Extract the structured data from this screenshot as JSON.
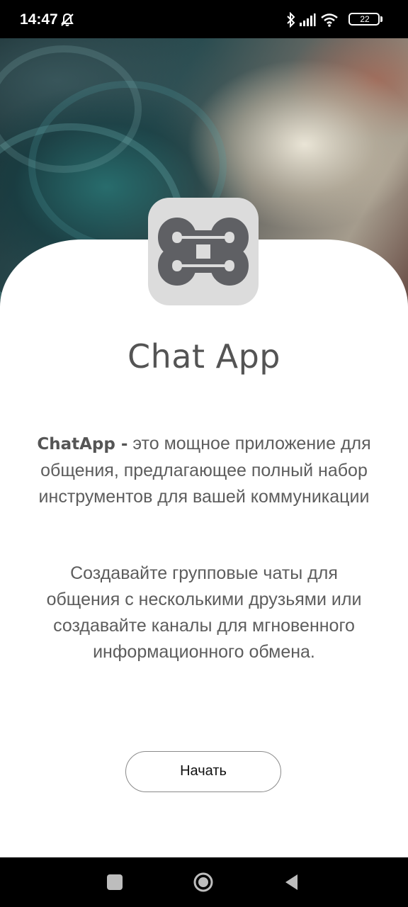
{
  "status_bar": {
    "time": "14:47",
    "battery_level": "22",
    "icons": [
      "mute-icon",
      "bluetooth-icon",
      "signal-icon",
      "wifi-icon",
      "battery-icon"
    ]
  },
  "app": {
    "title": "Chat App",
    "brand_name": "ChatApp -",
    "description_1": " это мощное приложение для общения, предлагающее полный набор инструментов для вашей коммуникации",
    "description_2": "Создавайте групповые чаты для общения с несколькими друзьями или создавайте каналы для мгновенного информационного обмена.",
    "start_button": "Начать"
  },
  "nav_bar": {
    "icons": [
      "recents-icon",
      "home-icon",
      "back-icon"
    ]
  },
  "colors": {
    "logo_bg": "#dcdcdc",
    "logo_mark": "#5f6064",
    "title_text": "#545454",
    "body_text": "#5d5d5d"
  }
}
